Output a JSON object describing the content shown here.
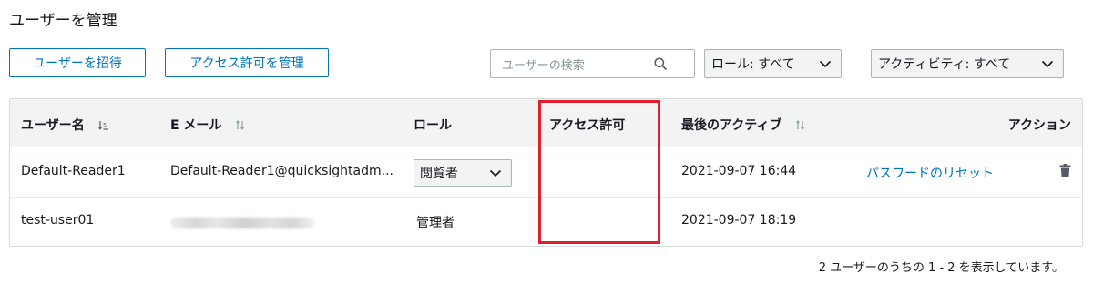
{
  "page": {
    "title": "ユーザーを管理"
  },
  "toolbar": {
    "invite_label": "ユーザーを招待",
    "manage_access_label": "アクセス許可を管理",
    "search_placeholder": "ユーザーの検索",
    "role_filter": "ロール: すべて",
    "activity_filter": "アクティビティ: すべて"
  },
  "table": {
    "columns": [
      "ユーザー名",
      "E メール",
      "ロール",
      "アクセス許可",
      "最後のアクティブ",
      "アクション"
    ],
    "rows": [
      {
        "username": "Default-Reader1",
        "email": "Default-Reader1@quicksightadm...",
        "role": "閲覧者",
        "permissions": "",
        "last_active": "2021-09-07 16:44",
        "action_link": "パスワードのリセット"
      },
      {
        "username": "test-user01",
        "email": "",
        "role": "管理者",
        "permissions": "",
        "last_active": "2021-09-07 18:19",
        "action_link": ""
      }
    ]
  },
  "footer": {
    "summary": "2 ユーザーのうちの 1 - 2 を表示しています。"
  },
  "colors": {
    "accent": "#0073bb",
    "highlight": "#e0202f",
    "header_bg": "#f2f3f3",
    "border": "#d5dbdb"
  },
  "icons": [
    "search-icon",
    "chevron-down-icon",
    "sort-icon",
    "trash-icon"
  ]
}
